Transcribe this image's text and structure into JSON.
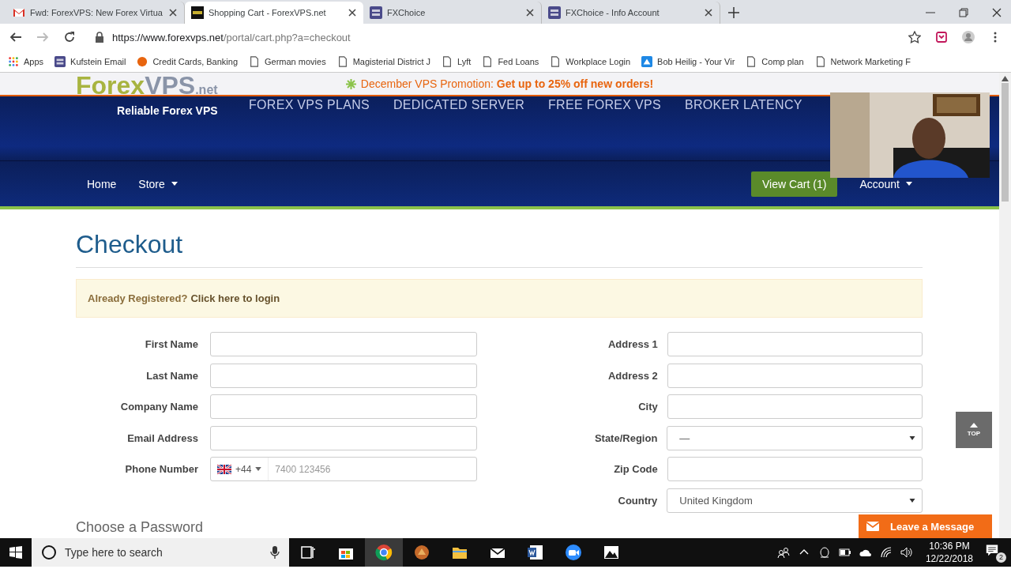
{
  "browser": {
    "tabs": [
      {
        "title": "Fwd: ForexVPS: New Forex Virtua",
        "kind": "mail",
        "selected": false
      },
      {
        "title": "Shopping Cart - ForexVPS.net",
        "kind": "vps",
        "selected": true
      },
      {
        "title": "FXChoice",
        "kind": "fx",
        "selected": false
      },
      {
        "title": "FXChoice - Info Account",
        "kind": "fx",
        "selected": false
      }
    ],
    "address": {
      "host": "https://www.forexvps.net",
      "path": "/portal/cart.php?a=checkout"
    },
    "bookmarks": [
      {
        "label": "Apps",
        "kind": "grid"
      },
      {
        "label": "Kufstein Email",
        "kind": "fx"
      },
      {
        "label": "Credit Cards, Banking",
        "kind": "circle"
      },
      {
        "label": "German movies",
        "kind": "page"
      },
      {
        "label": "Magisterial District J",
        "kind": "page"
      },
      {
        "label": "Lyft",
        "kind": "page"
      },
      {
        "label": "Fed Loans",
        "kind": "page"
      },
      {
        "label": "Workplace Login",
        "kind": "page"
      },
      {
        "label": "Bob Heilig - Your Vir",
        "kind": "blue"
      },
      {
        "label": "Comp plan",
        "kind": "page"
      },
      {
        "label": "Network Marketing F",
        "kind": "page"
      }
    ]
  },
  "site": {
    "logo": {
      "first": "Forex",
      "second": "VPS",
      "suffix": ".net",
      "tagline": "Reliable Forex VPS"
    },
    "promo": {
      "label": "December VPS Promotion:",
      "offer": "Get up to 25% off new orders!"
    },
    "top_nav": [
      "FOREX VPS PLANS",
      "DEDICATED SERVER",
      "FREE FOREX VPS",
      "BROKER LATENCY"
    ],
    "main_nav": [
      {
        "label": "Home",
        "dropdown": false
      },
      {
        "label": "Store",
        "dropdown": true
      }
    ],
    "cart_button": "View Cart (1)",
    "account": {
      "label": "Account",
      "dropdown": true
    }
  },
  "page": {
    "title": "Checkout",
    "alert": {
      "text": "Already Registered?",
      "link": "Click here to login"
    },
    "left_fields": [
      {
        "label": "First Name",
        "kind": "text"
      },
      {
        "label": "Last Name",
        "kind": "text"
      },
      {
        "label": "Company Name",
        "kind": "text"
      },
      {
        "label": "Email Address",
        "kind": "text"
      },
      {
        "label": "Phone Number",
        "kind": "phone",
        "code": "+44",
        "placeholder": "7400 123456"
      }
    ],
    "right_fields": [
      {
        "label": "Address 1",
        "kind": "text"
      },
      {
        "label": "Address 2",
        "kind": "text"
      },
      {
        "label": "City",
        "kind": "text"
      },
      {
        "label": "State/Region",
        "kind": "select",
        "value": "—"
      },
      {
        "label": "Zip Code",
        "kind": "text"
      },
      {
        "label": "Country",
        "kind": "select",
        "value": "United Kingdom"
      }
    ],
    "section_heading": "Choose a Password"
  },
  "widgets": {
    "top_button": "TOP",
    "chat": "Leave a Message"
  },
  "taskbar": {
    "search_placeholder": "Type here to search",
    "time": "10:36 PM",
    "date": "12/22/2018",
    "notifications": "2"
  }
}
